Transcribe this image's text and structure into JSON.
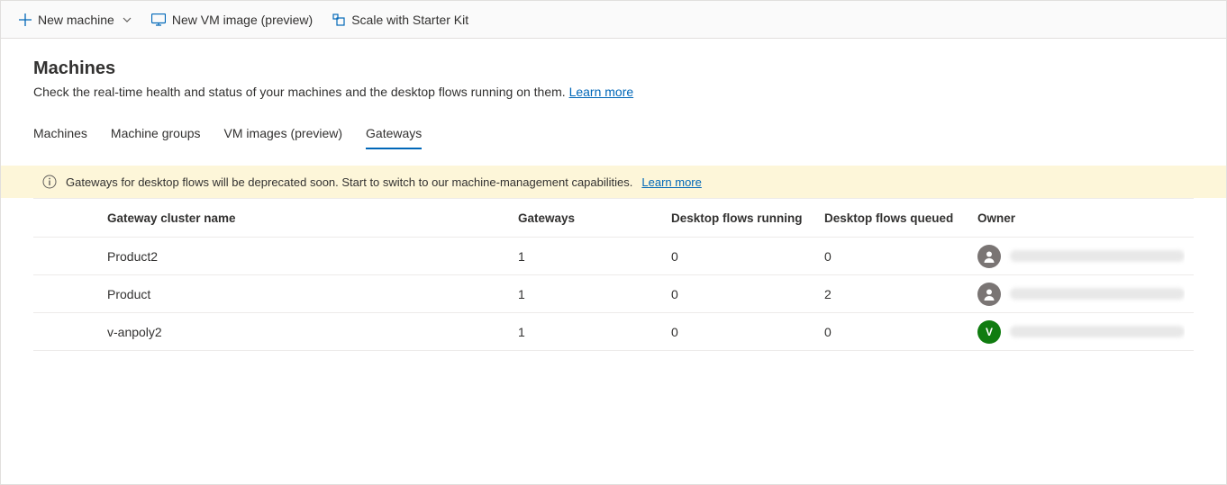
{
  "toolbar": {
    "new_machine": "New machine",
    "new_vm": "New VM image (preview)",
    "scale_kit": "Scale with Starter Kit"
  },
  "header": {
    "title": "Machines",
    "subtitle": "Check the real-time health and status of your machines and the desktop flows running on them.",
    "learn_more": "Learn more"
  },
  "tabs": {
    "machines": "Machines",
    "groups": "Machine groups",
    "vm": "VM images (preview)",
    "gateways": "Gateways",
    "active": "gateways"
  },
  "banner": {
    "text": "Gateways for desktop flows will be deprecated soon. Start to switch to our machine-management capabilities.",
    "learn_more": "Learn more"
  },
  "table": {
    "headers": {
      "name": "Gateway cluster name",
      "gateways": "Gateways",
      "running": "Desktop flows running",
      "queued": "Desktop flows queued",
      "owner": "Owner"
    },
    "rows": [
      {
        "name": "Product2",
        "gateways": "1",
        "running": "0",
        "queued": "0",
        "avatar_type": "person",
        "avatar_initial": ""
      },
      {
        "name": "Product",
        "gateways": "1",
        "running": "0",
        "queued": "2",
        "avatar_type": "person",
        "avatar_initial": ""
      },
      {
        "name": "v-anpoly2",
        "gateways": "1",
        "running": "0",
        "queued": "0",
        "avatar_type": "green",
        "avatar_initial": "V"
      }
    ]
  }
}
